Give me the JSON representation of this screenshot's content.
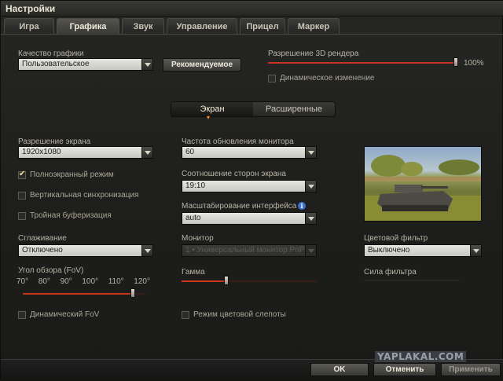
{
  "window": {
    "title": "Настройки"
  },
  "tabs": [
    "Игра",
    "Графика",
    "Звук",
    "Управление",
    "Прицел",
    "Маркер"
  ],
  "active_tab": "Графика",
  "top": {
    "quality_label": "Качество графики",
    "quality_value": "Пользовательское",
    "recommended_button": "Рекомендуемое",
    "render_res_label": "Разрешение 3D рендера",
    "render_res_value": "100%",
    "render_res_level": 1.0,
    "dynamic_change_label": "Динамическое изменение"
  },
  "subtabs": [
    "Экран",
    "Расширенные"
  ],
  "left": {
    "screen_res_label": "Разрешение экрана",
    "screen_res_value": "1920x1080",
    "fullscreen_label": "Полноэкранный режим",
    "vsync_label": "Вертикальная синхронизация",
    "triple_buffer_label": "Тройная буферизация",
    "aa_label": "Сглаживание",
    "aa_value": "Отключено",
    "fov_label": "Угол обзора (FoV)",
    "fov_ticks": [
      "70°",
      "80°",
      "90°",
      "100°",
      "110°",
      "120°"
    ],
    "fov_level": 0.9,
    "dynamic_fov_label": "Динамический FoV"
  },
  "mid": {
    "refresh_label": "Частота обновления монитора",
    "refresh_value": "60",
    "aspect_label": "Соотношение сторон экрана",
    "aspect_value": "19:10",
    "scale_label": "Масштабирование интерфейса",
    "scale_value": "auto",
    "monitor_label": "Монитор",
    "monitor_value": "1 • Универсальный монитор PnP (",
    "gamma_label": "Гамма",
    "gamma_level": 0.33,
    "colorblind_label": "Режим цветовой слепоты"
  },
  "right": {
    "filter_label": "Цветовой фильтр",
    "filter_value": "Выключено",
    "filter_strength_label": "Сила фильтра"
  },
  "footer": {
    "ok": "OK",
    "cancel": "Отменить",
    "apply": "Применить"
  },
  "watermark": "YAPLAKAL.COM",
  "colors": {
    "accent": "#c7361c",
    "glow": "#ff8a1f"
  }
}
